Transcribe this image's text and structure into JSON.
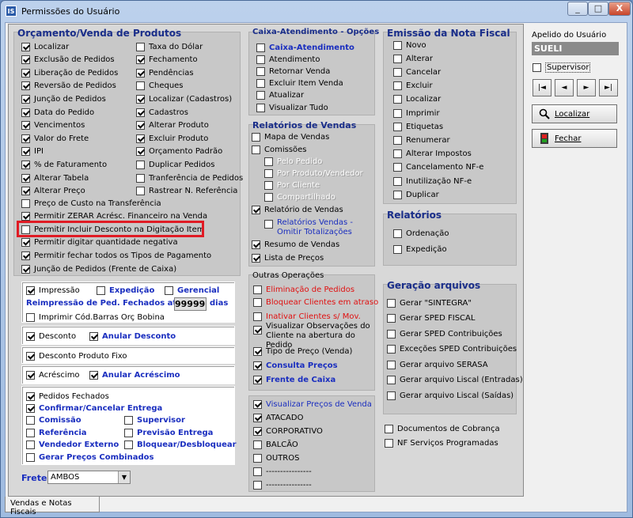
{
  "window": {
    "title": "Permissões do Usuário",
    "icon_text": "IS",
    "buttons": {
      "minimize": "_",
      "maximize": "□",
      "close": "X"
    }
  },
  "orcamento": {
    "title": "Orçamento/Venda de Produtos",
    "left": [
      {
        "label": "Localizar",
        "checked": true
      },
      {
        "label": "Exclusão de Pedidos",
        "checked": true
      },
      {
        "label": "Liberação de Pedidos",
        "checked": true
      },
      {
        "label": "Reversão de Pedidos",
        "checked": true
      },
      {
        "label": "Junção de Pedidos",
        "checked": true
      },
      {
        "label": "Data do Pedido",
        "checked": true
      },
      {
        "label": "Vencimentos",
        "checked": true
      },
      {
        "label": "Valor do Frete",
        "checked": true
      },
      {
        "label": "IPI",
        "checked": true
      },
      {
        "label": "% de Faturamento",
        "checked": true
      },
      {
        "label": "Alterar Tabela",
        "checked": true
      },
      {
        "label": "Alterar Preço",
        "checked": true
      }
    ],
    "right": [
      {
        "label": "Taxa do Dólar",
        "checked": false
      },
      {
        "label": "Fechamento",
        "checked": true
      },
      {
        "label": "Pendências",
        "checked": true
      },
      {
        "label": "Cheques",
        "checked": false
      },
      {
        "label": "Localizar (Cadastros)",
        "checked": true
      },
      {
        "label": "Cadastros",
        "checked": true
      },
      {
        "label": "Alterar Produto",
        "checked": true
      },
      {
        "label": "Excluir Produto",
        "checked": true
      },
      {
        "label": "Orçamento Padrão",
        "checked": true
      },
      {
        "label": "Duplicar Pedidos",
        "checked": false
      },
      {
        "label": "Tranferência de Pedidos",
        "checked": false
      },
      {
        "label": "Rastrear N. Referência",
        "checked": false
      }
    ],
    "full": [
      {
        "label": "Preço de Custo na Transferência",
        "checked": false
      },
      {
        "label": "Permitir ZERAR Acrésc. Financeiro na Venda",
        "checked": true
      },
      {
        "label": "Permitir Incluir Desconto na Digitação Item",
        "checked": false
      },
      {
        "label": "Permitir digitar quantidade negativa",
        "checked": true
      },
      {
        "label": "Permitir fechar todos os Tipos de Pagamento",
        "checked": true
      },
      {
        "label": "Junção de Pedidos (Frente de Caixa)",
        "checked": true
      }
    ]
  },
  "impressao": {
    "impressao": "Impressão",
    "expedicao": "Expedição",
    "gerencial": "Gerencial",
    "reimp_label": "Reimpressão de Ped. Fechados até",
    "reimp_value": "99999",
    "reimp_unit": "dias",
    "codbarras": "Imprimir Cód.Barras Orç Bobina"
  },
  "desconto": {
    "desconto": "Desconto",
    "anular": "Anular Desconto",
    "fixo": "Desconto Produto Fixo"
  },
  "acrescimo": {
    "acrescimo": "Acréscimo",
    "anular": "Anular Acréscimo"
  },
  "pedidos": {
    "fechados": "Pedidos Fechados",
    "confirmar": "Confirmar/Cancelar Entrega",
    "comissao": "Comissão",
    "supervisor": "Supervisor",
    "referencia": "Referência",
    "previsao": "Previsão Entrega",
    "vendedor": "Vendedor Externo",
    "bloquear": "Bloquear/Desbloquear",
    "gerar": "Gerar Preços Combinados"
  },
  "frete": {
    "label": "Frete",
    "value": "AMBOS"
  },
  "caixa": {
    "title": "Caixa-Atendimento - Opções",
    "items": [
      {
        "label": "Caixa-Atendimento",
        "style": "blue",
        "checked": false
      },
      {
        "label": "Atendimento",
        "checked": false
      },
      {
        "label": "Retornar Venda",
        "checked": false
      },
      {
        "label": "Excluir Item Venda",
        "checked": false
      },
      {
        "label": "Atualizar",
        "checked": false
      },
      {
        "label": "Visualizar Tudo",
        "checked": false
      }
    ]
  },
  "relvendas": {
    "title": "Relatórios de Vendas",
    "mapa": "Mapa de Vendas",
    "comissoes": "Comissões",
    "sub": [
      "Pelo Pedido",
      "Por Produto/Vendedor",
      "Por Cliente",
      "Compartilhado"
    ],
    "relatorio": "Relatório de Vendas",
    "relomitir": "Relatórios Vendas - Omitir Totalizações",
    "resumo": "Resumo de Vendas",
    "lista": "Lista de Preços"
  },
  "outras": {
    "title": "Outras Operações",
    "elim": "Eliminação de Pedidos",
    "bloq": "Bloquear Clientes em atraso",
    "inativar": "Inativar Clientes s/ Mov.",
    "visualizar": "Visualizar Observações do Cliente na abertura do Pedido",
    "tipo": "Tipo de Preço (Venda)",
    "consulta": "Consulta Preços",
    "frente": "Frente de Caixa"
  },
  "precos": {
    "items": [
      {
        "label": "Visualizar Preços de Venda",
        "checked": true,
        "style": "blue2"
      },
      {
        "label": "ATACADO",
        "checked": true
      },
      {
        "label": "CORPORATIVO",
        "checked": true
      },
      {
        "label": "BALCÃO",
        "checked": false
      },
      {
        "label": "OUTROS",
        "checked": false
      },
      {
        "label": "----------------",
        "checked": false
      },
      {
        "label": "----------------",
        "checked": false
      }
    ]
  },
  "nota": {
    "title": "Emissão da Nota Fiscal",
    "items": [
      "Novo",
      "Alterar",
      "Cancelar",
      "Excluir",
      "Localizar",
      "Imprimir",
      "Etiquetas",
      "Renumerar",
      "Alterar Impostos",
      "Cancelamento NF-e",
      "Inutilização NF-e",
      "Duplicar"
    ]
  },
  "relatorios": {
    "title": "Relatórios",
    "items": [
      "Ordenação",
      "Expedição"
    ]
  },
  "geracao": {
    "title": "Geração arquivos",
    "items": [
      "Gerar \"SINTEGRA\"",
      "Gerar SPED FISCAL",
      "Gerar SPED Contribuições",
      "Exceções SPED Contribuições",
      "Gerar arquivo SERASA",
      "Gerar arquivo Liscal (Entradas)",
      "Gerar arquivo Liscal (Saídas)"
    ]
  },
  "docs": {
    "cobranca": "Documentos de Cobrança",
    "nf": "NF Serviços Programadas"
  },
  "right": {
    "apelido_label": "Apelido do Usuário",
    "apelido": "SUELI",
    "supervisor": "Supervisor",
    "nav": [
      "|◄",
      "◄",
      "►",
      "►|"
    ],
    "localizar": "Localizar",
    "fechar": "Fechar"
  },
  "tab": {
    "label": "Vendas e Notas Fiscais"
  }
}
